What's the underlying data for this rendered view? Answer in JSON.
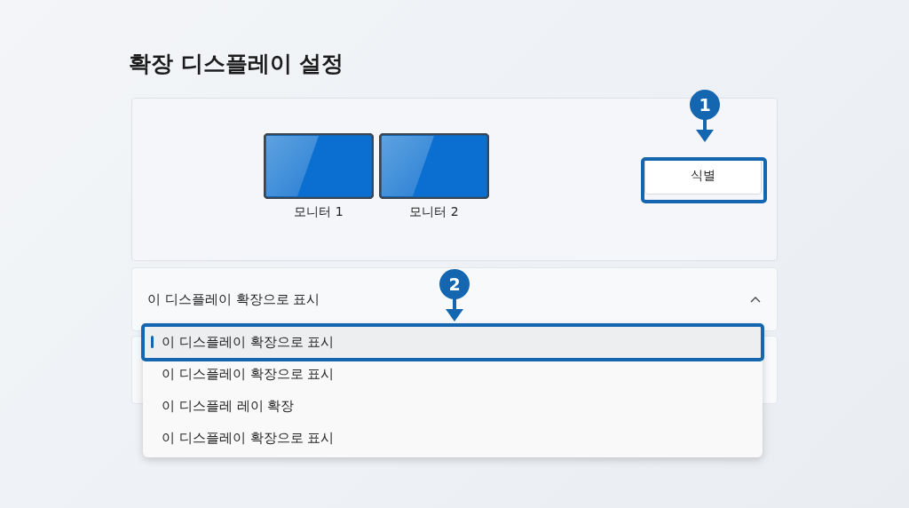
{
  "title": "확장 디스플레이 설정",
  "monitors": [
    {
      "label": "모니터 1"
    },
    {
      "label": "모니터 2"
    }
  ],
  "identify_button": {
    "label": "식별"
  },
  "dropdown": {
    "label": "이 디스플레이 확장으로 표시",
    "expanded": true,
    "options": [
      {
        "label": "이 디스플레이 확장으로 표시",
        "selected": true
      },
      {
        "label": "이 디스플레이 확장으로 표시",
        "selected": false
      },
      {
        "label": "이 디스플레 레이 확장",
        "selected": false
      },
      {
        "label": "이 디스플레이 확장으로 표시",
        "selected": false
      }
    ]
  },
  "callouts": [
    {
      "number": "1"
    },
    {
      "number": "2"
    }
  ]
}
